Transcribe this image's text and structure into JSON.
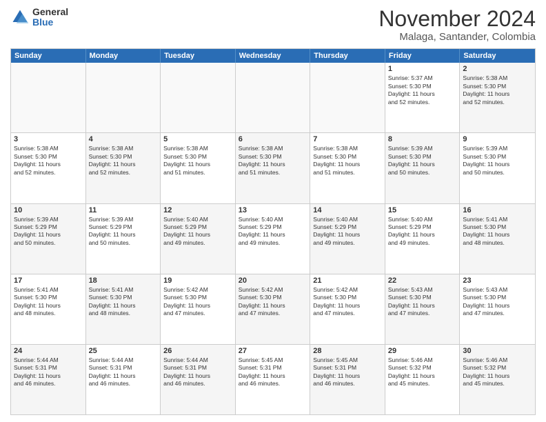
{
  "logo": {
    "general": "General",
    "blue": "Blue"
  },
  "header": {
    "month": "November 2024",
    "location": "Malaga, Santander, Colombia"
  },
  "weekdays": [
    "Sunday",
    "Monday",
    "Tuesday",
    "Wednesday",
    "Thursday",
    "Friday",
    "Saturday"
  ],
  "rows": [
    [
      {
        "day": "",
        "info": "",
        "empty": true
      },
      {
        "day": "",
        "info": "",
        "empty": true
      },
      {
        "day": "",
        "info": "",
        "empty": true
      },
      {
        "day": "",
        "info": "",
        "empty": true
      },
      {
        "day": "",
        "info": "",
        "empty": true
      },
      {
        "day": "1",
        "info": "Sunrise: 5:37 AM\nSunset: 5:30 PM\nDaylight: 11 hours\nand 52 minutes."
      },
      {
        "day": "2",
        "info": "Sunrise: 5:38 AM\nSunset: 5:30 PM\nDaylight: 11 hours\nand 52 minutes.",
        "alt": true
      }
    ],
    [
      {
        "day": "3",
        "info": "Sunrise: 5:38 AM\nSunset: 5:30 PM\nDaylight: 11 hours\nand 52 minutes."
      },
      {
        "day": "4",
        "info": "Sunrise: 5:38 AM\nSunset: 5:30 PM\nDaylight: 11 hours\nand 52 minutes.",
        "alt": true
      },
      {
        "day": "5",
        "info": "Sunrise: 5:38 AM\nSunset: 5:30 PM\nDaylight: 11 hours\nand 51 minutes."
      },
      {
        "day": "6",
        "info": "Sunrise: 5:38 AM\nSunset: 5:30 PM\nDaylight: 11 hours\nand 51 minutes.",
        "alt": true
      },
      {
        "day": "7",
        "info": "Sunrise: 5:38 AM\nSunset: 5:30 PM\nDaylight: 11 hours\nand 51 minutes."
      },
      {
        "day": "8",
        "info": "Sunrise: 5:39 AM\nSunset: 5:30 PM\nDaylight: 11 hours\nand 50 minutes.",
        "alt": true
      },
      {
        "day": "9",
        "info": "Sunrise: 5:39 AM\nSunset: 5:30 PM\nDaylight: 11 hours\nand 50 minutes."
      }
    ],
    [
      {
        "day": "10",
        "info": "Sunrise: 5:39 AM\nSunset: 5:29 PM\nDaylight: 11 hours\nand 50 minutes.",
        "alt": true
      },
      {
        "day": "11",
        "info": "Sunrise: 5:39 AM\nSunset: 5:29 PM\nDaylight: 11 hours\nand 50 minutes."
      },
      {
        "day": "12",
        "info": "Sunrise: 5:40 AM\nSunset: 5:29 PM\nDaylight: 11 hours\nand 49 minutes.",
        "alt": true
      },
      {
        "day": "13",
        "info": "Sunrise: 5:40 AM\nSunset: 5:29 PM\nDaylight: 11 hours\nand 49 minutes."
      },
      {
        "day": "14",
        "info": "Sunrise: 5:40 AM\nSunset: 5:29 PM\nDaylight: 11 hours\nand 49 minutes.",
        "alt": true
      },
      {
        "day": "15",
        "info": "Sunrise: 5:40 AM\nSunset: 5:29 PM\nDaylight: 11 hours\nand 49 minutes."
      },
      {
        "day": "16",
        "info": "Sunrise: 5:41 AM\nSunset: 5:30 PM\nDaylight: 11 hours\nand 48 minutes.",
        "alt": true
      }
    ],
    [
      {
        "day": "17",
        "info": "Sunrise: 5:41 AM\nSunset: 5:30 PM\nDaylight: 11 hours\nand 48 minutes."
      },
      {
        "day": "18",
        "info": "Sunrise: 5:41 AM\nSunset: 5:30 PM\nDaylight: 11 hours\nand 48 minutes.",
        "alt": true
      },
      {
        "day": "19",
        "info": "Sunrise: 5:42 AM\nSunset: 5:30 PM\nDaylight: 11 hours\nand 47 minutes."
      },
      {
        "day": "20",
        "info": "Sunrise: 5:42 AM\nSunset: 5:30 PM\nDaylight: 11 hours\nand 47 minutes.",
        "alt": true
      },
      {
        "day": "21",
        "info": "Sunrise: 5:42 AM\nSunset: 5:30 PM\nDaylight: 11 hours\nand 47 minutes."
      },
      {
        "day": "22",
        "info": "Sunrise: 5:43 AM\nSunset: 5:30 PM\nDaylight: 11 hours\nand 47 minutes.",
        "alt": true
      },
      {
        "day": "23",
        "info": "Sunrise: 5:43 AM\nSunset: 5:30 PM\nDaylight: 11 hours\nand 47 minutes."
      }
    ],
    [
      {
        "day": "24",
        "info": "Sunrise: 5:44 AM\nSunset: 5:31 PM\nDaylight: 11 hours\nand 46 minutes.",
        "alt": true
      },
      {
        "day": "25",
        "info": "Sunrise: 5:44 AM\nSunset: 5:31 PM\nDaylight: 11 hours\nand 46 minutes."
      },
      {
        "day": "26",
        "info": "Sunrise: 5:44 AM\nSunset: 5:31 PM\nDaylight: 11 hours\nand 46 minutes.",
        "alt": true
      },
      {
        "day": "27",
        "info": "Sunrise: 5:45 AM\nSunset: 5:31 PM\nDaylight: 11 hours\nand 46 minutes."
      },
      {
        "day": "28",
        "info": "Sunrise: 5:45 AM\nSunset: 5:31 PM\nDaylight: 11 hours\nand 46 minutes.",
        "alt": true
      },
      {
        "day": "29",
        "info": "Sunrise: 5:46 AM\nSunset: 5:32 PM\nDaylight: 11 hours\nand 45 minutes."
      },
      {
        "day": "30",
        "info": "Sunrise: 5:46 AM\nSunset: 5:32 PM\nDaylight: 11 hours\nand 45 minutes.",
        "alt": true
      }
    ]
  ]
}
